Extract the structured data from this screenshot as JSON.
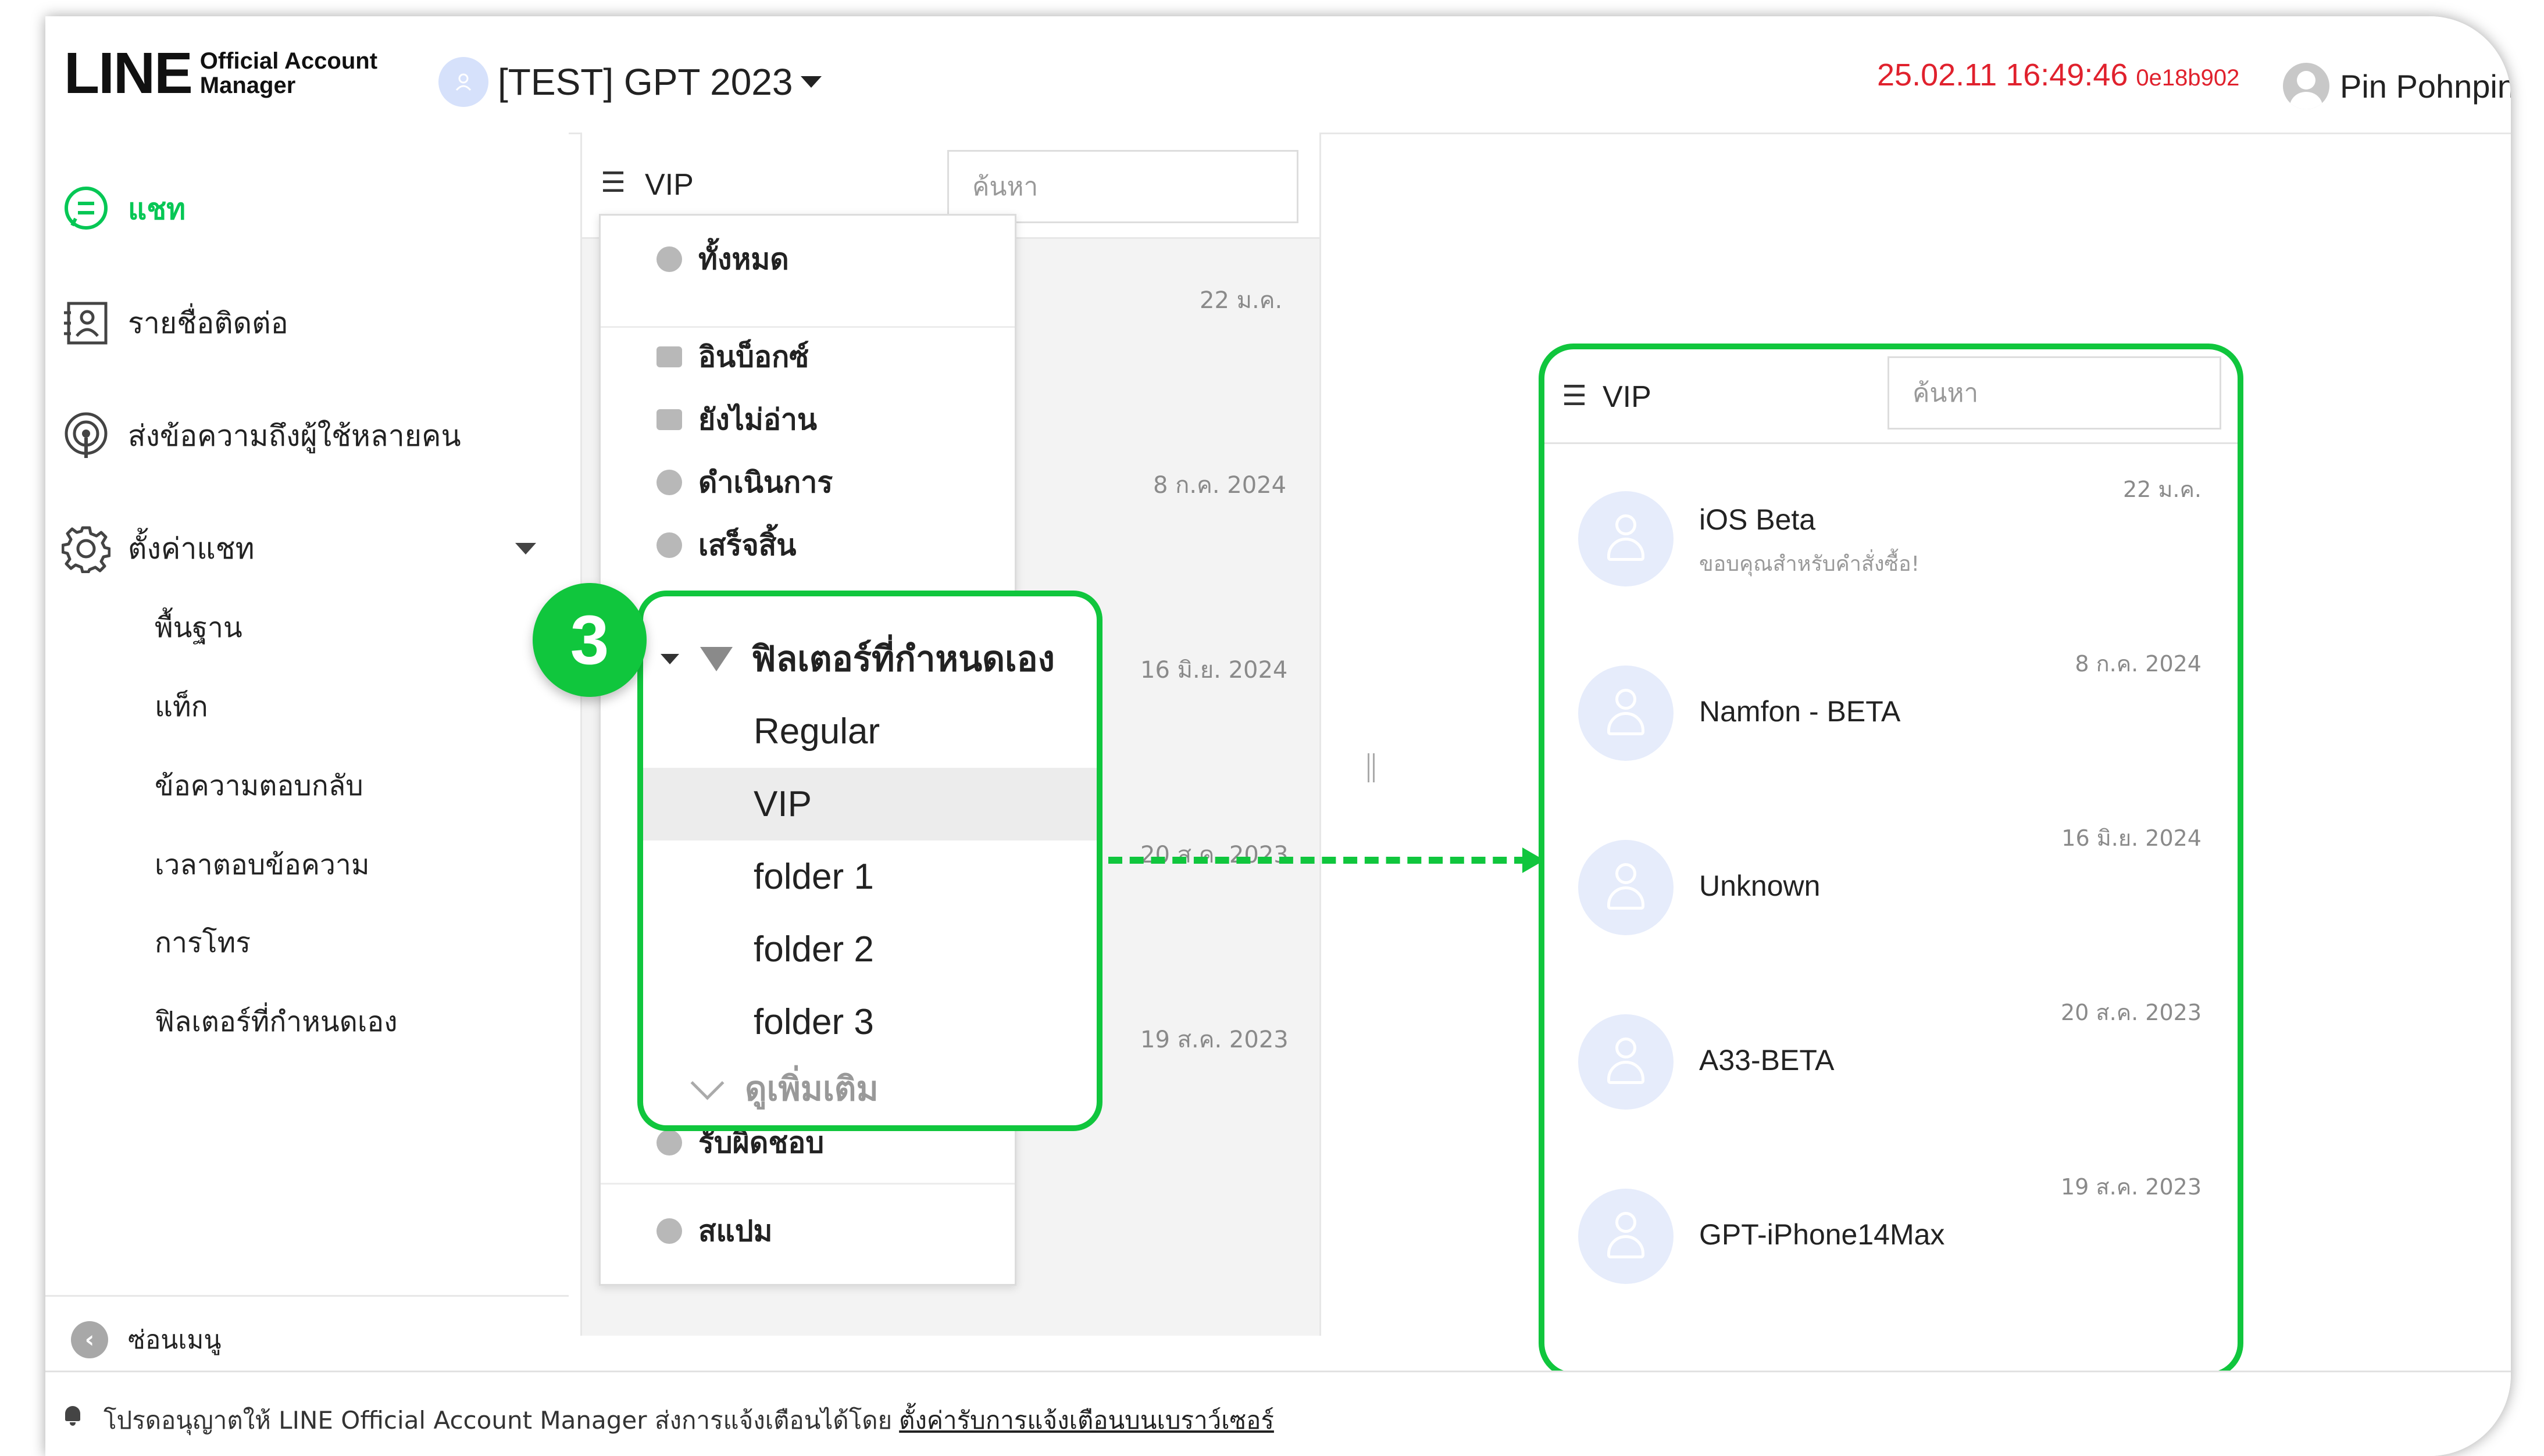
{
  "header": {
    "logo_text": "LINE",
    "logo_sub_1": "Official Account",
    "logo_sub_2": "Manager",
    "account_name": "[TEST] GPT 2023",
    "timestamp": "25.02.11 16:49:46",
    "build": "0e18b902",
    "user_name": "Pin Pohnpin"
  },
  "sidebar": {
    "items": [
      {
        "label": "แชท",
        "icon": "chat-icon"
      },
      {
        "label": "รายชื่อติดต่อ",
        "icon": "contacts-icon"
      },
      {
        "label": "ส่งข้อความถึงผู้ใช้หลายคน",
        "icon": "broadcast-icon"
      },
      {
        "label": "ตั้งค่าแชท",
        "icon": "gear-icon"
      }
    ],
    "sub_items": [
      "พื้นฐาน",
      "แท็ก",
      "ข้อความตอบกลับ",
      "เวลาตอบข้อความ",
      "การโทร",
      "ฟิลเตอร์ที่กำหนดเอง"
    ],
    "hide_menu": "ซ่อนเมนู"
  },
  "chat_list": {
    "filter": "VIP",
    "search_placeholder": "ค้นหา",
    "dates": [
      "22 ม.ค.",
      "8 ก.ค. 2024",
      "16 มิ.ย. 2024",
      "20 ส.ค. 2023",
      "19 ส.ค. 2023"
    ],
    "dropdown": [
      "ทั้งหมด",
      "อินบ็อกซ์",
      "ยังไม่อ่าน",
      "ดำเนินการ",
      "เสร็จสิ้น",
      "รับผิดชอบ",
      "สแปม"
    ]
  },
  "popout": {
    "badge": "3",
    "title": "ฟิลเตอร์ที่กำหนดเอง",
    "items": [
      "Regular",
      "VIP",
      "folder 1",
      "folder 2",
      "folder 3"
    ],
    "selected": "VIP",
    "more": "ดูเพิ่มเติม"
  },
  "panel": {
    "filter": "VIP",
    "search_placeholder": "ค้นหา",
    "chats": [
      {
        "name": "iOS Beta",
        "preview": "ขอบคุณสำหรับคำสั่งซื้อ!",
        "date": "22 ม.ค."
      },
      {
        "name": "Namfon - BETA",
        "preview": "",
        "date": "8 ก.ค. 2024"
      },
      {
        "name": "Unknown",
        "preview": "",
        "date": "16 มิ.ย. 2024"
      },
      {
        "name": "A33-BETA",
        "preview": "",
        "date": "20 ส.ค. 2023"
      },
      {
        "name": "GPT-iPhone14Max",
        "preview": "",
        "date": "19 ส.ค. 2023"
      }
    ]
  },
  "footer": {
    "text": "โปรดอนุญาตให้ LINE Official Account Manager ส่งการแจ้งเตือนได้โดย",
    "link": "ตั้งค่ารับการแจ้งเตือนบนเบราว์เซอร์"
  },
  "colors": {
    "brand_green": "#06c755",
    "highlight_green": "#10c63d",
    "timestamp_red": "#e0212d"
  }
}
